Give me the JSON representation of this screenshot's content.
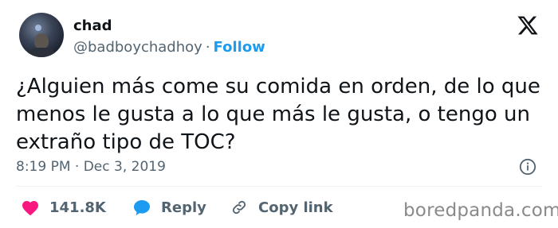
{
  "author": {
    "name": "chad",
    "handle": "@badboychadhoy",
    "separator": "·",
    "follow_label": "Follow"
  },
  "tweet": {
    "text": "¿Alguien más come su comida en orden, de lo que menos le gusta a lo que más le gusta, o tengo un extraño tipo de TOC?",
    "timestamp": "8:19 PM · Dec 3, 2019"
  },
  "actions": {
    "likes_count": "141.8K",
    "reply_label": "Reply",
    "copy_link_label": "Copy link"
  },
  "watermark": "boredpanda.com",
  "colors": {
    "like": "#f91880",
    "reply": "#1d9bf0",
    "follow": "#1d9bf0",
    "muted": "#536471",
    "text": "#0f1419"
  },
  "icons": [
    "x-logo-icon",
    "info-icon",
    "heart-icon",
    "speech-bubble-icon",
    "link-icon"
  ]
}
